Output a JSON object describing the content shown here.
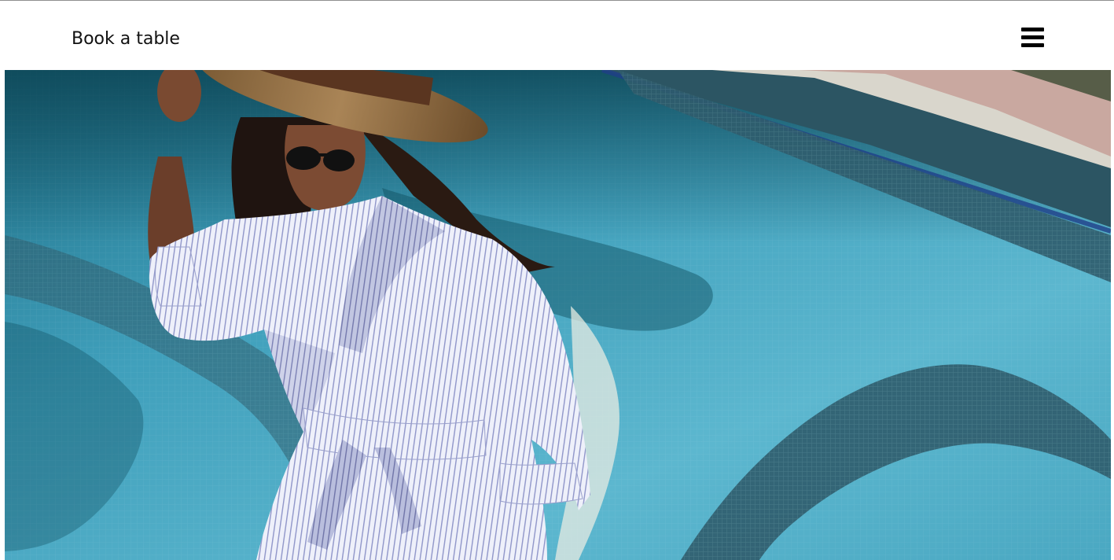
{
  "header": {
    "book_label": "Book a table",
    "menu_icon": "hamburger-menu-icon"
  },
  "hero": {
    "image_subject": "woman-in-striped-shirt-dress-by-pool"
  }
}
